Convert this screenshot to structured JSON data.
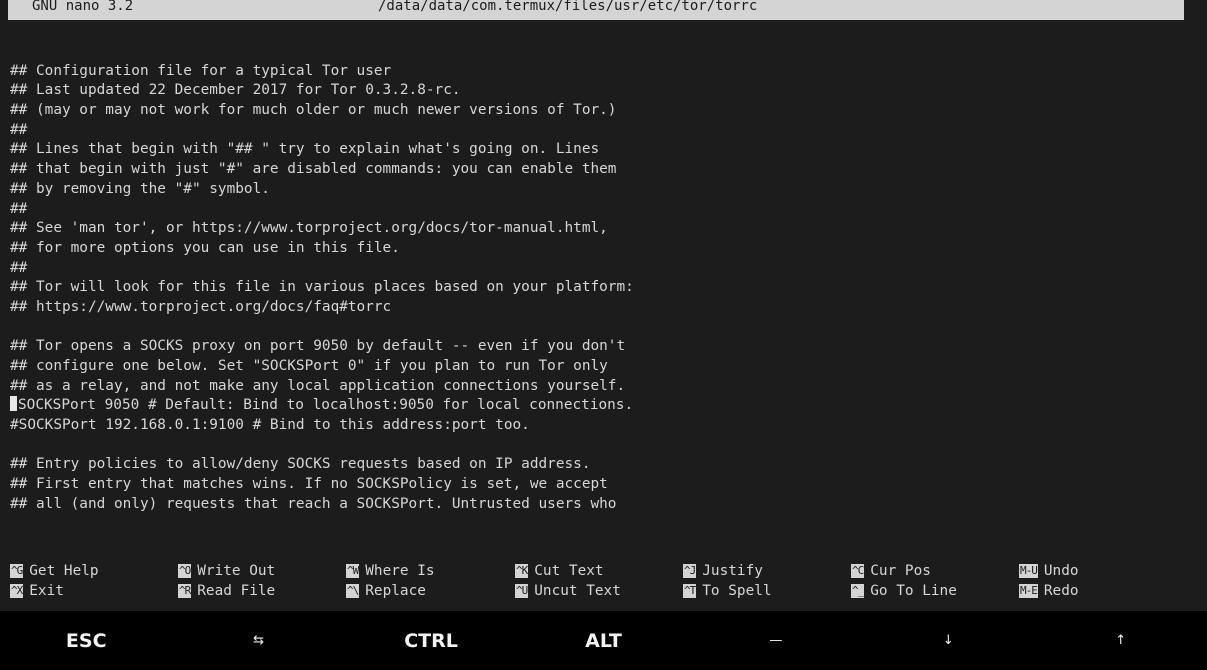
{
  "titlebar": {
    "app": "GNU nano 3.2",
    "file": "/data/data/com.termux/files/usr/etc/tor/torrc"
  },
  "editor": {
    "lines": [
      "",
      "## Configuration file for a typical Tor user",
      "## Last updated 22 December 2017 for Tor 0.3.2.8-rc.",
      "## (may or may not work for much older or much newer versions of Tor.)",
      "##",
      "## Lines that begin with \"## \" try to explain what's going on. Lines",
      "## that begin with just \"#\" are disabled commands: you can enable them",
      "## by removing the \"#\" symbol.",
      "##",
      "## See 'man tor', or https://www.torproject.org/docs/tor-manual.html,",
      "## for more options you can use in this file.",
      "##",
      "## Tor will look for this file in various places based on your platform:",
      "## https://www.torproject.org/docs/faq#torrc",
      "",
      "## Tor opens a SOCKS proxy on port 9050 by default -- even if you don't",
      "## configure one below. Set \"SOCKSPort 0\" if you plan to run Tor only",
      "## as a relay, and not make any local application connections yourself.",
      "SOCKSPort 9050 # Default: Bind to localhost:9050 for local connections.",
      "#SOCKSPort 192.168.0.1:9100 # Bind to this address:port too.",
      "",
      "## Entry policies to allow/deny SOCKS requests based on IP address.",
      "## First entry that matches wins. If no SOCKSPolicy is set, we accept",
      "## all (and only) requests that reach a SOCKSPort. Untrusted users who"
    ]
  },
  "shortcuts": [
    {
      "key": "^G",
      "label": "Get Help",
      "name": "get-help"
    },
    {
      "key": "^O",
      "label": "Write Out",
      "name": "write-out"
    },
    {
      "key": "^W",
      "label": "Where Is",
      "name": "where-is"
    },
    {
      "key": "^K",
      "label": "Cut Text",
      "name": "cut-text"
    },
    {
      "key": "^J",
      "label": "Justify",
      "name": "justify"
    },
    {
      "key": "^C",
      "label": "Cur Pos",
      "name": "cur-pos"
    },
    {
      "key": "M-U",
      "label": "Undo",
      "name": "undo"
    },
    {
      "key": "^X",
      "label": "Exit",
      "name": "exit"
    },
    {
      "key": "^R",
      "label": "Read File",
      "name": "read-file"
    },
    {
      "key": "^\\",
      "label": "Replace",
      "name": "replace"
    },
    {
      "key": "^U",
      "label": "Uncut Text",
      "name": "uncut-text"
    },
    {
      "key": "^T",
      "label": "To Spell",
      "name": "to-spell"
    },
    {
      "key": "^_",
      "label": "Go To Line",
      "name": "go-to-line"
    },
    {
      "key": "M-E",
      "label": "Redo",
      "name": "redo"
    }
  ],
  "extra_keys": [
    {
      "label": "ESC",
      "name": "esc-key"
    },
    {
      "label": "⇆",
      "name": "tab-key"
    },
    {
      "label": "CTRL",
      "name": "ctrl-key"
    },
    {
      "label": "ALT",
      "name": "alt-key"
    },
    {
      "label": "—",
      "name": "dash-key"
    },
    {
      "label": "↓",
      "name": "arrow-down-key"
    },
    {
      "label": "↑",
      "name": "arrow-up-key"
    }
  ]
}
